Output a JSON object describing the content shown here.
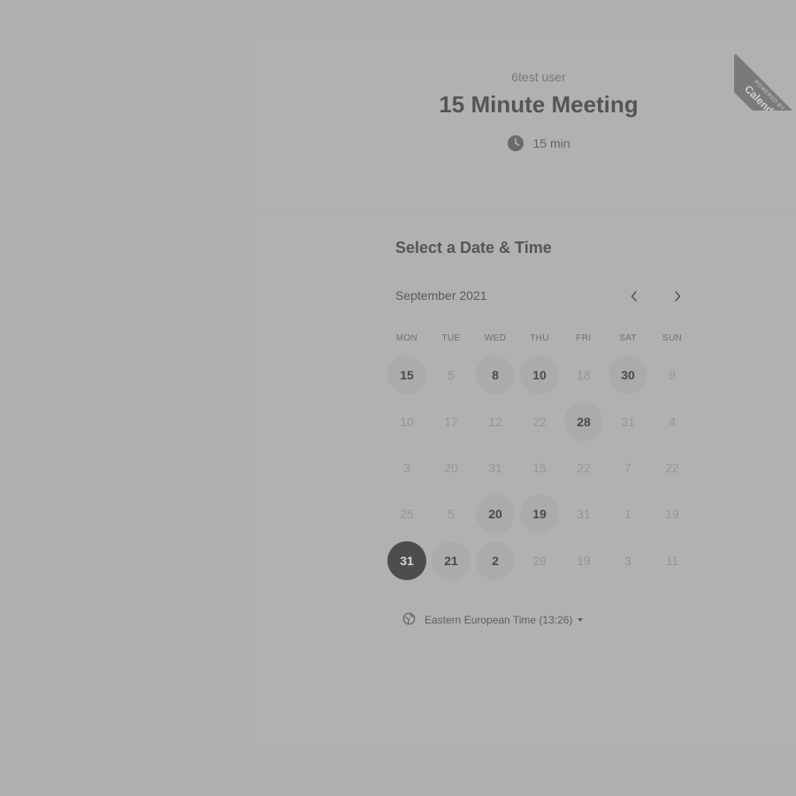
{
  "event": {
    "owner": "6test user",
    "title": "15 Minute Meeting",
    "duration": "15 min"
  },
  "section_title": "Select a Date & Time",
  "calendar": {
    "month_label": "September 2021",
    "prev_icon": "chevron-left-icon",
    "next_icon": "chevron-right-icon",
    "weekdays": [
      "MON",
      "TUE",
      "WED",
      "THU",
      "FRI",
      "SAT",
      "SUN"
    ],
    "weeks": [
      [
        {
          "label": "15",
          "state": "available"
        },
        {
          "label": "5",
          "state": "disabled"
        },
        {
          "label": "8",
          "state": "available"
        },
        {
          "label": "10",
          "state": "available"
        },
        {
          "label": "18",
          "state": "disabled"
        },
        {
          "label": "30",
          "state": "available"
        },
        {
          "label": "9",
          "state": "disabled"
        }
      ],
      [
        {
          "label": "10",
          "state": "disabled"
        },
        {
          "label": "17",
          "state": "disabled"
        },
        {
          "label": "12",
          "state": "disabled"
        },
        {
          "label": "22",
          "state": "disabled"
        },
        {
          "label": "28",
          "state": "available"
        },
        {
          "label": "31",
          "state": "disabled"
        },
        {
          "label": "4",
          "state": "disabled"
        }
      ],
      [
        {
          "label": "3",
          "state": "disabled"
        },
        {
          "label": "20",
          "state": "disabled"
        },
        {
          "label": "31",
          "state": "disabled"
        },
        {
          "label": "15",
          "state": "disabled"
        },
        {
          "label": "22",
          "state": "disabled"
        },
        {
          "label": "7",
          "state": "disabled"
        },
        {
          "label": "22",
          "state": "disabled"
        }
      ],
      [
        {
          "label": "25",
          "state": "disabled"
        },
        {
          "label": "5",
          "state": "disabled"
        },
        {
          "label": "20",
          "state": "available"
        },
        {
          "label": "19",
          "state": "available"
        },
        {
          "label": "31",
          "state": "disabled"
        },
        {
          "label": "1",
          "state": "disabled"
        },
        {
          "label": "19",
          "state": "disabled"
        }
      ],
      [
        {
          "label": "31",
          "state": "selected"
        },
        {
          "label": "21",
          "state": "available"
        },
        {
          "label": "2",
          "state": "available"
        },
        {
          "label": "29",
          "state": "disabled"
        },
        {
          "label": "19",
          "state": "disabled"
        },
        {
          "label": "3",
          "state": "disabled"
        },
        {
          "label": "11",
          "state": "disabled"
        }
      ]
    ]
  },
  "timezone": {
    "icon": "globe-icon",
    "label": "Eastern European Time (13:26)"
  },
  "ribbon": {
    "line1": "POWERED BY",
    "line2": "Calendly"
  },
  "colors": {
    "overlay": "#b0b0b0",
    "selected_day": "#4d4d4d",
    "available_day": "#ababab"
  }
}
